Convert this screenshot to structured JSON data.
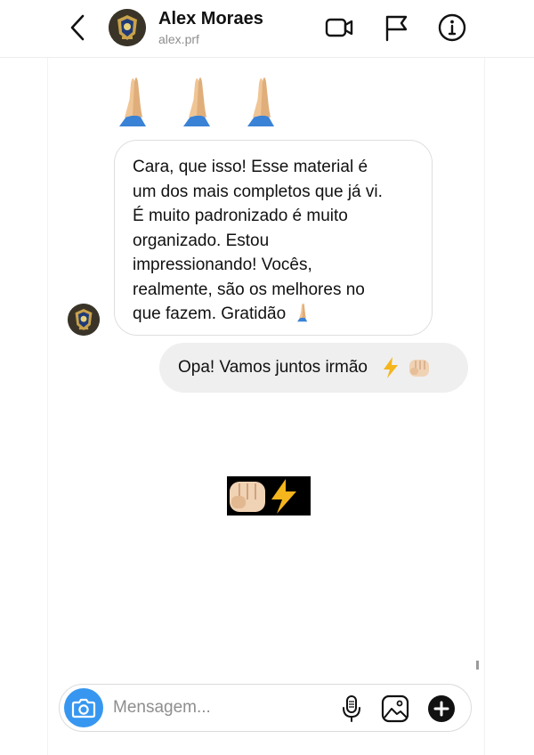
{
  "header": {
    "name": "Alex Moraes",
    "username": "alex.prf",
    "icons": [
      "chevron-left-icon",
      "video-call-icon",
      "flag-icon",
      "info-icon"
    ]
  },
  "messages": {
    "prayer_emojis": "🙏🙏🙏",
    "incoming_lines": [
      "Cara, que isso! Esse material é",
      "um dos mais completos que já vi.",
      "É muito padronizado é muito",
      "organizado. Estou",
      "impressionando! Vocês,",
      "realmente, são os melhores no",
      "que fazem. Gratidão"
    ],
    "incoming_trailing_emoji": "🙏",
    "outgoing_text": "Opa! Vamos juntos irmão",
    "outgoing_emojis": "⚡👊🏼",
    "sticker_emojis": "👊🏼⚡"
  },
  "composer": {
    "placeholder": "Mensagem...",
    "icons": [
      "camera-icon",
      "microphone-icon",
      "gallery-icon",
      "plus-icon"
    ]
  },
  "colors": {
    "accent_blue": "#3797f0",
    "outgoing_bubble": "#efefef",
    "incoming_border": "#dedede",
    "secondary_text": "#8e8e8e"
  }
}
